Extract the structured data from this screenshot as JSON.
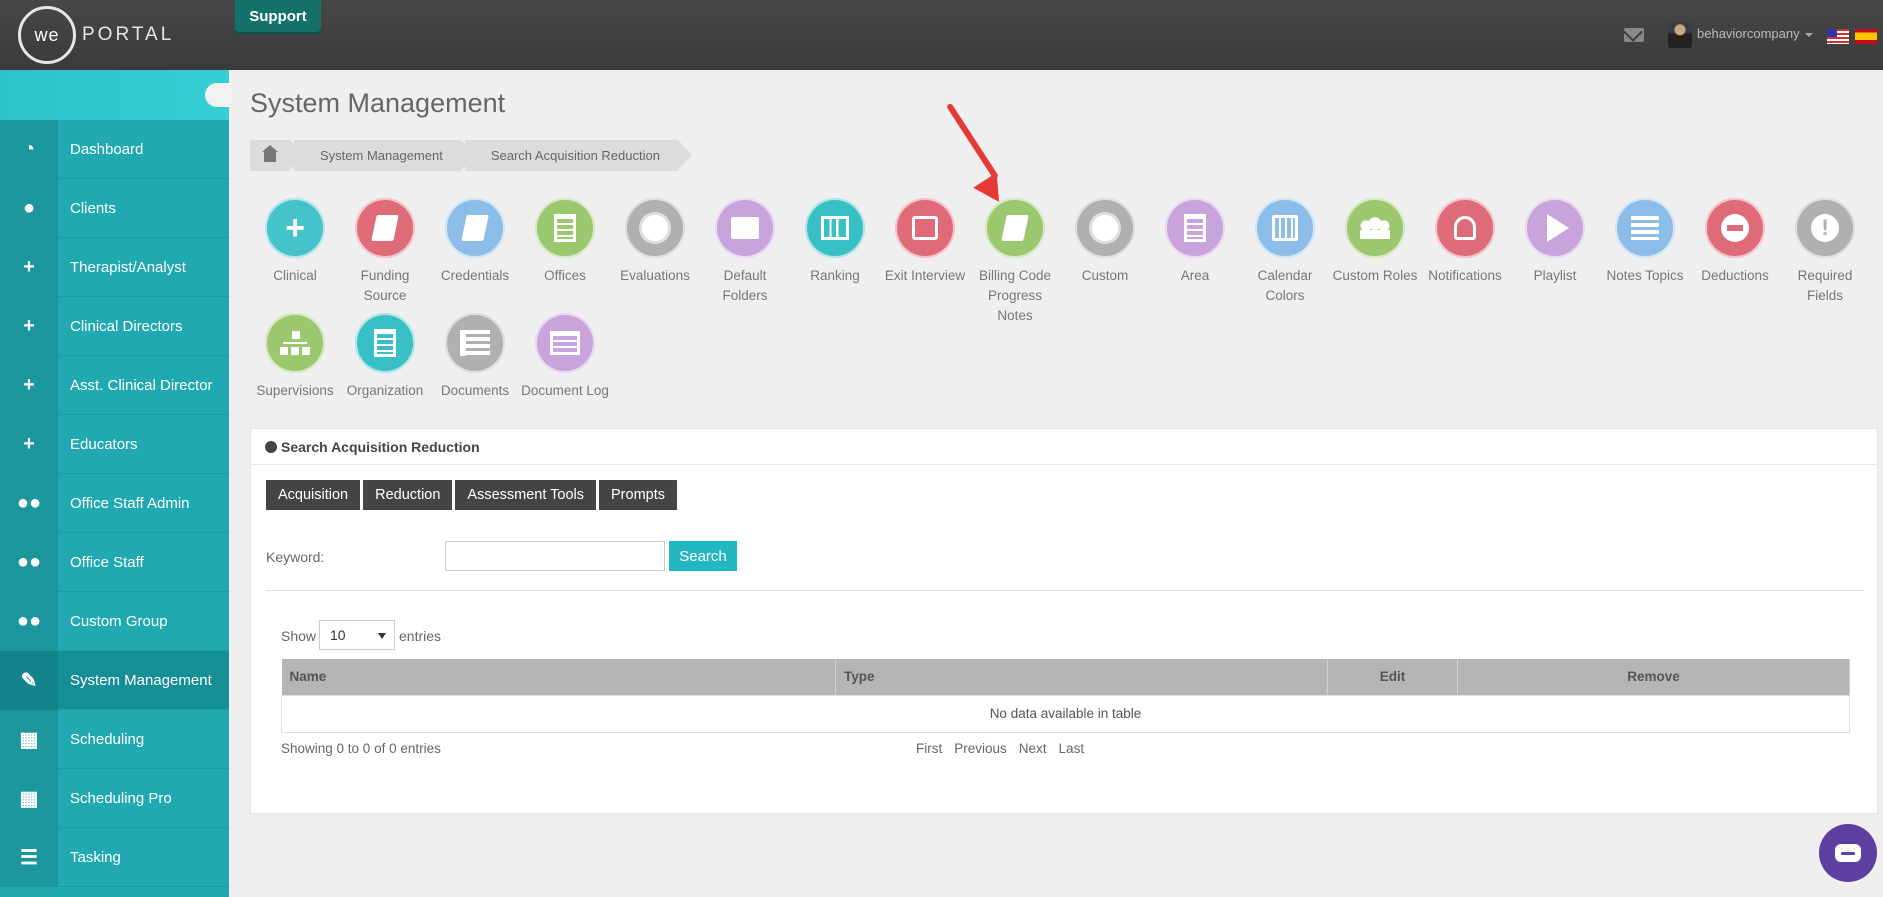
{
  "header": {
    "logo_we": "we",
    "logo_word": "PORTAL",
    "support_label": "Support",
    "user_name": "behaviorcompany"
  },
  "sidebar": {
    "items": [
      {
        "label": "Dashboard",
        "icon": "dashboard-icon",
        "glyph": "◔"
      },
      {
        "label": "Clients",
        "icon": "user-icon",
        "glyph": "●"
      },
      {
        "label": "Therapist/Analyst",
        "icon": "plus-icon",
        "glyph": "+"
      },
      {
        "label": "Clinical Directors",
        "icon": "plus-icon",
        "glyph": "+"
      },
      {
        "label": "Asst. Clinical Director",
        "icon": "plus-icon",
        "glyph": "+"
      },
      {
        "label": "Educators",
        "icon": "plus-icon",
        "glyph": "+"
      },
      {
        "label": "Office Staff Admin",
        "icon": "users-icon",
        "glyph": "●●"
      },
      {
        "label": "Office Staff",
        "icon": "users-icon",
        "glyph": "●●"
      },
      {
        "label": "Custom Group",
        "icon": "users-icon",
        "glyph": "●●"
      },
      {
        "label": "System Management",
        "icon": "wrench-icon",
        "glyph": "✎"
      },
      {
        "label": "Scheduling",
        "icon": "calendar-icon",
        "glyph": "▦"
      },
      {
        "label": "Scheduling Pro",
        "icon": "calendar-icon",
        "glyph": "▦"
      },
      {
        "label": "Tasking",
        "icon": "tasks-icon",
        "glyph": "☰"
      }
    ],
    "active_index": 9
  },
  "main": {
    "title": "System Management",
    "breadcrumb": [
      "System Management",
      "Search Acquisition Reduction"
    ]
  },
  "tiles": [
    {
      "label": "Clinical",
      "color": "#45c3cb",
      "icon": "plus-icon"
    },
    {
      "label": "Funding Source",
      "color": "#e06b78",
      "icon": "book-icon"
    },
    {
      "label": "Credentials",
      "color": "#8bbde8",
      "icon": "book-icon"
    },
    {
      "label": "Offices",
      "color": "#9bc76e",
      "icon": "building-icon"
    },
    {
      "label": "Evaluations",
      "color": "#b0b0b0",
      "icon": "cog-icon"
    },
    {
      "label": "Default Folders",
      "color": "#c9a3dc",
      "icon": "folder-icon"
    },
    {
      "label": "Ranking",
      "color": "#39c0c6",
      "icon": "bar-chart-icon"
    },
    {
      "label": "Exit Interview",
      "color": "#e06b78",
      "icon": "check-square-icon"
    },
    {
      "label": "Billing Code Progress Notes",
      "color": "#9bc76e",
      "icon": "book-icon"
    },
    {
      "label": "Custom",
      "color": "#b0b0b0",
      "icon": "cog-icon"
    },
    {
      "label": "Area",
      "color": "#c9a3dc",
      "icon": "building-icon"
    },
    {
      "label": "Calendar Colors",
      "color": "#8bbde8",
      "icon": "calendar-icon"
    },
    {
      "label": "Custom Roles",
      "color": "#9bc76e",
      "icon": "users-icon"
    },
    {
      "label": "Notifications",
      "color": "#e06b78",
      "icon": "bell-icon"
    },
    {
      "label": "Playlist",
      "color": "#c9a3dc",
      "icon": "play-icon"
    },
    {
      "label": "Notes Topics",
      "color": "#8bbde8",
      "icon": "list-alt-icon"
    },
    {
      "label": "Deductions",
      "color": "#e06b78",
      "icon": "minus-circle-icon"
    },
    {
      "label": "Required Fields",
      "color": "#b0b0b0",
      "icon": "exclamation-icon"
    },
    {
      "label": "Supervisions",
      "color": "#9bc76e",
      "icon": "sitemap-icon"
    },
    {
      "label": "Organization",
      "color": "#39c0c6",
      "icon": "hospital-icon"
    },
    {
      "label": "Documents",
      "color": "#b0b0b0",
      "icon": "list-icon"
    },
    {
      "label": "Document Log",
      "color": "#c9a3dc",
      "icon": "log-icon"
    }
  ],
  "panel": {
    "heading": "Search Acquisition Reduction",
    "tabs": [
      "Acquisition",
      "Reduction",
      "Assessment Tools",
      "Prompts"
    ],
    "keyword_label": "Keyword:",
    "keyword_value": "",
    "search_label": "Search",
    "show_label": "Show",
    "show_value": "10",
    "entries_label": "entries",
    "columns": [
      "Name",
      "Type",
      "Edit",
      "Remove"
    ],
    "empty_message": "No data available in table",
    "info": "Showing 0 to 0 of 0 entries",
    "pager": [
      "First",
      "Previous",
      "Next",
      "Last"
    ]
  }
}
